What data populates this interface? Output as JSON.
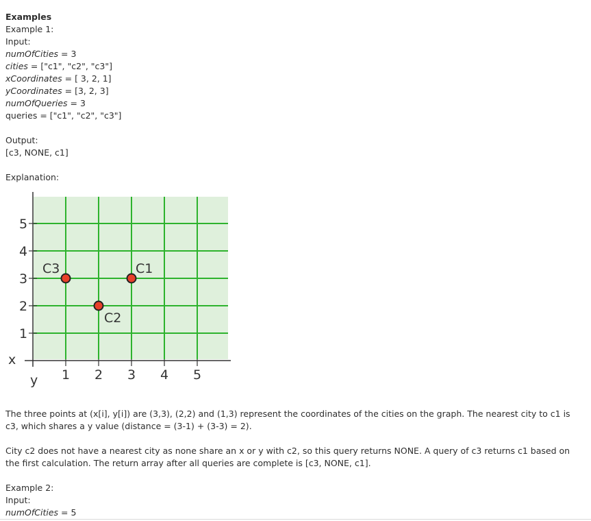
{
  "heading": "Examples",
  "example1": {
    "label": "Example 1:",
    "input_label": "Input:",
    "inputs": [
      {
        "name": "numOfCities",
        "value": " = 3",
        "italic": true
      },
      {
        "name": "cities",
        "value": " = [\"c1\", \"c2\", \"c3\"]",
        "italic": true
      },
      {
        "name": "xCoordinates",
        "value": " = [ 3, 2, 1]",
        "italic": true
      },
      {
        "name": "yCoordinates",
        "value": " = [3, 2, 3]",
        "italic": true
      },
      {
        "name": "numOfQueries",
        "value": " = 3",
        "italic": true
      },
      {
        "name": "queries",
        "value": " = [\"c1\", \"c2\", \"c3\"]",
        "italic": false
      }
    ],
    "output_label": "Output:",
    "output_value": "[c3, NONE, c1]",
    "explanation_label": "Explanation:"
  },
  "graph": {
    "x_axis_symbol": "x",
    "y_axis_symbol": "y",
    "x_ticks": [
      "1",
      "2",
      "3",
      "4",
      "5"
    ],
    "y_ticks": [
      "1",
      "2",
      "3",
      "4",
      "5"
    ],
    "background_color": "#dff0dc",
    "grid_color": "#2db32d",
    "point_color": "#e8402a",
    "cities": [
      {
        "label": "C1",
        "x": 3,
        "y": 3
      },
      {
        "label": "C2",
        "x": 2,
        "y": 2
      },
      {
        "label": "C3",
        "x": 1,
        "y": 3
      }
    ]
  },
  "paragraph1": "The three points at (x[i], y[i]) are (3,3), (2,2) and (1,3) represent the coordinates of the cities on the graph. The nearest city to c1 is c3, which shares a y value (distance = (3-1) + (3-3) = 2).",
  "paragraph2": "City c2 does not have a nearest city as none share an x or y with c2, so this query returns NONE. A query of c3 returns c1 based on the first calculation. The return array after all queries are complete is [c3, NONE, c1].",
  "example2": {
    "label": "Example 2:",
    "input_label": "Input:",
    "first_input_name": "numOfCities",
    "first_input_value": " = 5"
  }
}
